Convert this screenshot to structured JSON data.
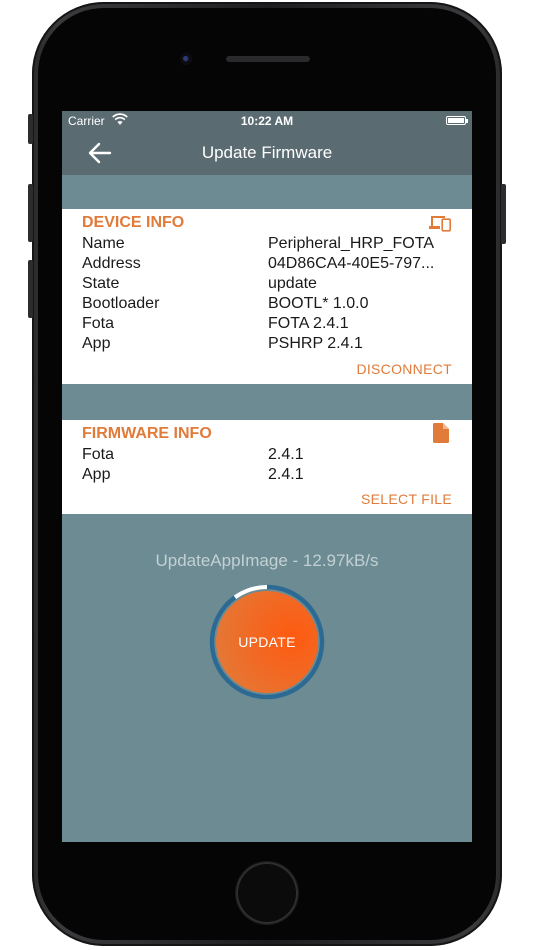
{
  "status_bar": {
    "carrier": "Carrier",
    "time": "10:22 AM"
  },
  "nav": {
    "title": "Update Firmware",
    "back_icon": "arrow-left-icon"
  },
  "device_info": {
    "header": "DEVICE INFO",
    "icon": "devices-icon",
    "rows": [
      {
        "label": "Name",
        "value": "Peripheral_HRP_FOTA"
      },
      {
        "label": "Address",
        "value": "04D86CA4-40E5-797..."
      },
      {
        "label": "State",
        "value": "update"
      },
      {
        "label": "Bootloader",
        "value": "BOOTL* 1.0.0"
      },
      {
        "label": "Fota",
        "value": "FOTA 2.4.1"
      },
      {
        "label": "App",
        "value": "PSHRP 2.4.1"
      }
    ],
    "action": "DISCONNECT"
  },
  "firmware_info": {
    "header": "FIRMWARE INFO",
    "icon": "file-icon",
    "rows": [
      {
        "label": "Fota",
        "value": "2.4.1"
      },
      {
        "label": "App",
        "value": "2.4.1"
      }
    ],
    "action": "SELECT FILE"
  },
  "update": {
    "progress_label": "UpdateAppImage - 12.97kB/s",
    "button_label": "UPDATE",
    "progress_fraction": 0.9
  },
  "colors": {
    "accent": "#e07b3a",
    "screen_bg": "#6c8b93",
    "nav_bg": "#5a6c72",
    "progress_ring": "#2d6a93"
  }
}
